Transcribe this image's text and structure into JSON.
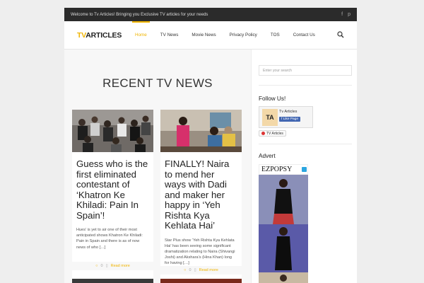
{
  "topbar": {
    "welcome": "Welcome to Tv Articles! Bringing you Exclusive TV articles for your needs"
  },
  "header": {
    "logo_tv": "TV",
    "logo_rest": "ARTICLES",
    "nav": [
      "Home",
      "TV News",
      "Movie News",
      "Privacy Policy",
      "TOS",
      "Contact Us"
    ],
    "active_nav": "Home"
  },
  "main": {
    "section_title": "RECENT TV NEWS",
    "posts": [
      {
        "title": "Guess who is the first eliminated contestant of ‘Khatron Ke Khiladi: Pain In Spain’!",
        "excerpt": "Hues’ is yet to air one of their most anticipated shows Khatron Ke Khiladi: Pain in Spain and there is as of now news of who […]",
        "comments": "0",
        "read_more": "Read more"
      },
      {
        "title": "FINALLY! Naira to mend her ways with Dadi and maker her happy in ‘Yeh Rishta Kya Kehlata Hai’",
        "excerpt": "Star Plus show ‘Yeh Rishta Kya Kehlata Hai’ has been seeing some significant dramatization relating to Naira (Shivangi Joshi) and Akshara’s (Hina Khan) long for having […]",
        "comments": "0",
        "read_more": "Read more"
      }
    ]
  },
  "sidebar": {
    "search_placeholder": "Enter your search",
    "follow_title": "Follow Us!",
    "fb_name": "Tv Articles",
    "fb_like": "Like Page",
    "fb_logo": "TA",
    "badge_label": "TV Articles",
    "advert_title": "Advert",
    "ad_brand": "EZPOPSY"
  },
  "colors": {
    "accent": "#f0b400",
    "topbar": "#2b2b2b"
  }
}
